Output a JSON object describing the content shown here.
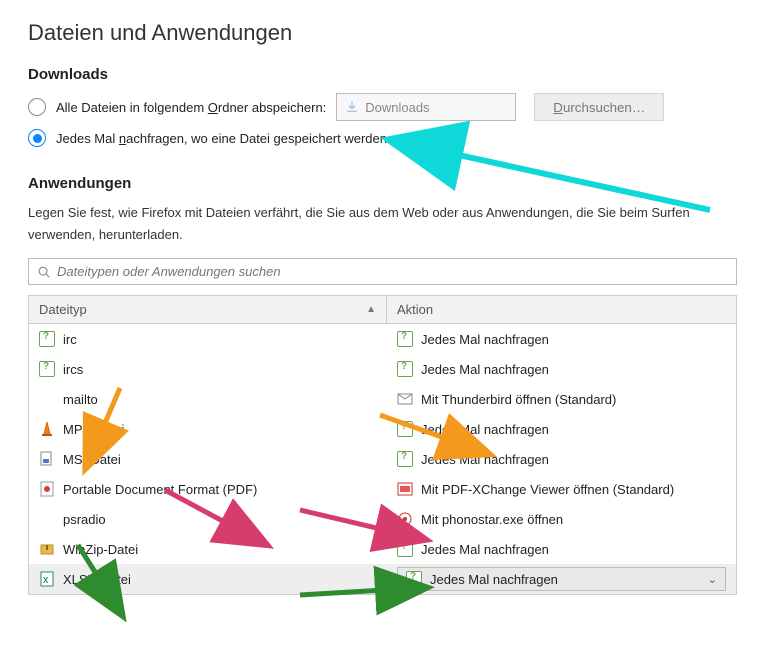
{
  "page_title": "Dateien und Anwendungen",
  "downloads": {
    "heading": "Downloads",
    "save_all_label_pre": "Alle Dateien in folgendem ",
    "save_all_label_u": "O",
    "save_all_label_post": "rdner abspeichern:",
    "path_placeholder": "Downloads",
    "browse_u": "D",
    "browse_rest": "urchsuchen…",
    "ask_label_pre": "Jedes Mal ",
    "ask_label_u": "n",
    "ask_label_post": "achfragen, wo eine Datei gespeichert werden soll"
  },
  "apps": {
    "heading": "Anwendungen",
    "description": "Legen Sie fest, wie Firefox mit Dateien verfährt, die Sie aus dem Web oder aus Anwendungen, die Sie beim Surfen verwenden, herunterladen.",
    "search_placeholder": "Dateitypen oder Anwendungen suchen",
    "col_type": "Dateityp",
    "col_action": "Aktion",
    "rows": [
      {
        "type": "irc",
        "action": "Jedes Mal nachfragen",
        "type_icon": "ask",
        "action_icon": "ask"
      },
      {
        "type": "ircs",
        "action": "Jedes Mal nachfragen",
        "type_icon": "ask",
        "action_icon": "ask"
      },
      {
        "type": "mailto",
        "action": "Mit Thunderbird öffnen (Standard)",
        "type_icon": "blank",
        "action_icon": "tb"
      },
      {
        "type": "MP4-Datei",
        "action": "Jedes Mal nachfragen",
        "type_icon": "vlc",
        "action_icon": "ask"
      },
      {
        "type": "MSI-Datei",
        "action": "Jedes Mal nachfragen",
        "type_icon": "msi",
        "action_icon": "ask"
      },
      {
        "type": "Portable Document Format (PDF)",
        "action": "Mit PDF-XChange Viewer öffnen (Standard)",
        "type_icon": "pdf",
        "action_icon": "pdfx"
      },
      {
        "type": "psradio",
        "action": "Mit phonostar.exe öffnen",
        "type_icon": "blank",
        "action_icon": "phono"
      },
      {
        "type": "WinZip-Datei",
        "action": "Jedes Mal nachfragen",
        "type_icon": "zip",
        "action_icon": "ask"
      },
      {
        "type": "XLSX-Datei",
        "action": "Jedes Mal nachfragen",
        "type_icon": "xlsx",
        "action_icon": "ask",
        "selected": true
      }
    ]
  }
}
